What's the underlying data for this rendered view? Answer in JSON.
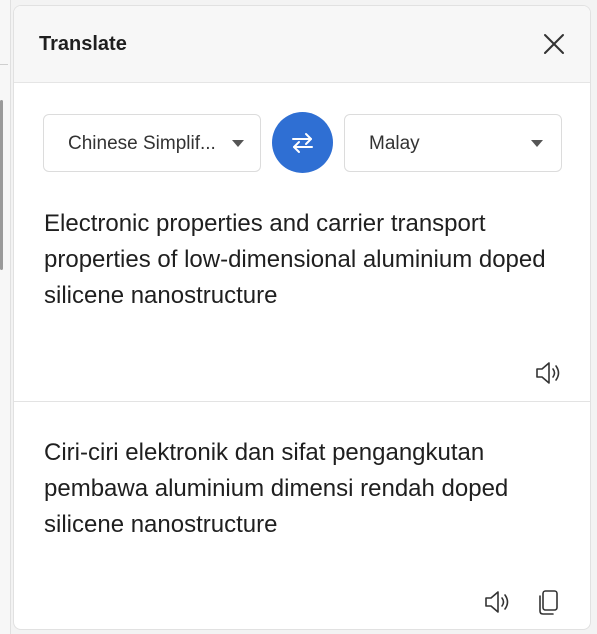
{
  "panel": {
    "title": "Translate"
  },
  "languages": {
    "source": "Chinese Simplif...",
    "target": "Malay"
  },
  "source_text": "Electronic properties and carrier transport properties of low-dimensional aluminium doped silicene nanostructure",
  "translated_text": "Ciri-ciri elektronik dan sifat pengangkutan pembawa aluminium dimensi rendah doped silicene nanostructure",
  "colors": {
    "accent": "#2f6fd3",
    "text": "#1f1f1f"
  },
  "icons": {
    "close": "close-icon",
    "swap": "swap-icon",
    "speaker": "speaker-icon",
    "copy": "copy-icon"
  }
}
